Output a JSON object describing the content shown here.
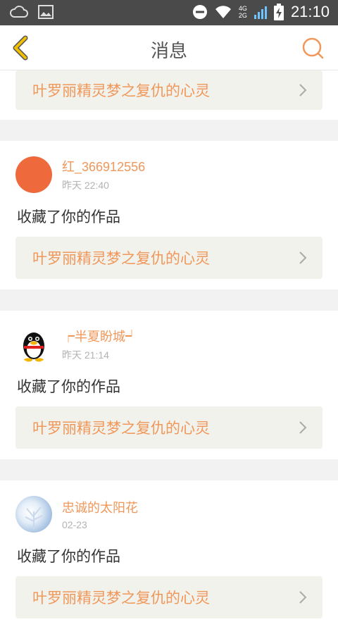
{
  "status_bar": {
    "time": "21:10",
    "network_top": "4G",
    "network_bottom": "2G"
  },
  "nav": {
    "title": "消息",
    "back_icon": "chevron-left-icon",
    "search_icon": "search-icon"
  },
  "colors": {
    "accent": "#f0975a",
    "back": "#f0c000"
  },
  "top_partial": {
    "work_title": "叶罗丽精灵梦之复仇的心灵"
  },
  "notifications": [
    {
      "username": "红_366912556",
      "time": "昨天 22:40",
      "message": "收藏了你的作品",
      "work_title": "叶罗丽精灵梦之复仇的心灵",
      "avatar": "orange-circle-avatar"
    },
    {
      "username": "┍半夏盼城┙",
      "time": "昨天 21:14",
      "message": "收藏了你的作品",
      "work_title": "叶罗丽精灵梦之复仇的心灵",
      "avatar": "qq-penguin-avatar"
    },
    {
      "username": "忠诚的太阳花",
      "time": "02-23",
      "message": "收藏了你的作品",
      "work_title": "叶罗丽精灵梦之复仇的心灵",
      "avatar": "snowy-tree-avatar"
    }
  ]
}
